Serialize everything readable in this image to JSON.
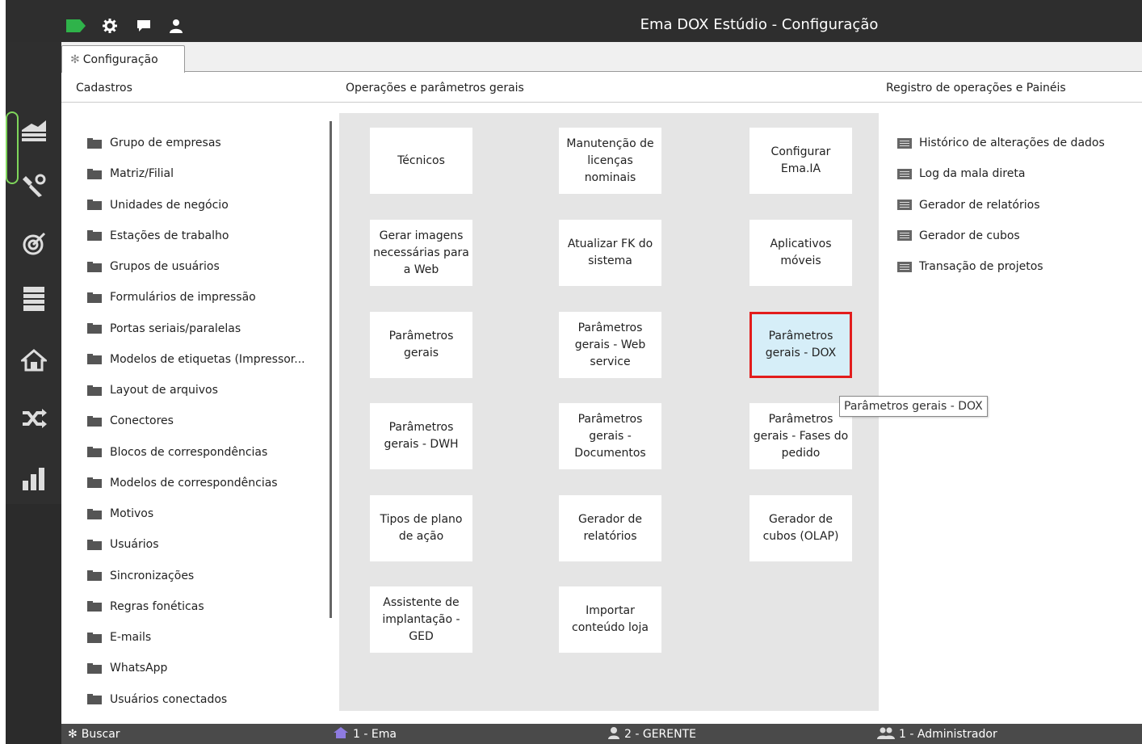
{
  "window": {
    "title": "Ema DOX Estúdio - Configuração",
    "toolbar_icons": [
      "tag-icon",
      "gear-icon",
      "chat-icon",
      "user-icon"
    ]
  },
  "sidebar": {
    "icons": [
      "dashboard-icon",
      "tools-icon",
      "target-icon",
      "table-icon",
      "home-icon",
      "shuffle-icon",
      "bar-chart-icon"
    ],
    "accent": "#7fd65b"
  },
  "tab": {
    "label": "Configuração"
  },
  "sections": {
    "cadastros": "Cadastros",
    "operacoes": "Operações e parâmetros gerais",
    "registro": "Registro de operações e Painéis"
  },
  "cadastros_items": [
    "Grupo de empresas",
    "Matriz/Filial",
    "Unidades de negócio",
    "Estações de trabalho",
    "Grupos de usuários",
    "Formulários de impressão",
    "Portas seriais/paralelas",
    "Modelos de etiquetas (Impressor...",
    "Layout de arquivos",
    "Conectores",
    "Blocos de correspondências",
    "Modelos de correspondências",
    "Motivos",
    "Usuários",
    "Sincronizações",
    "Regras fonéticas",
    "E-mails",
    "WhatsApp",
    "Usuários conectados"
  ],
  "tiles": [
    "Técnicos",
    "Manutenção de licenças nominais",
    "Configurar Ema.IA",
    "Gerar imagens necessárias para a Web",
    "Atualizar FK do sistema",
    "Aplicativos móveis",
    "Parâmetros gerais",
    "Parâmetros gerais - Web service",
    "Parâmetros gerais - DOX",
    "Parâmetros gerais - DWH",
    "Parâmetros gerais - Documentos",
    "Parâmetros gerais - Fases do pedido",
    "Tipos de plano de ação",
    "Gerador de relatórios",
    "Gerador de cubos (OLAP)",
    "Assistente de implantação - GED",
    "Importar conteúdo loja"
  ],
  "selected_tile_color": "#e21d1d",
  "tooltip": "Parâmetros gerais - DOX",
  "registro_items": [
    "Histórico de alterações de dados",
    "Log da mala direta",
    "Gerador de relatórios",
    "Gerador de cubos",
    "Transação de projetos"
  ],
  "statusbar": {
    "search": "Buscar",
    "company": "1 - Ema",
    "profile": "2 - GERENTE",
    "user": "1 - Administrador"
  }
}
